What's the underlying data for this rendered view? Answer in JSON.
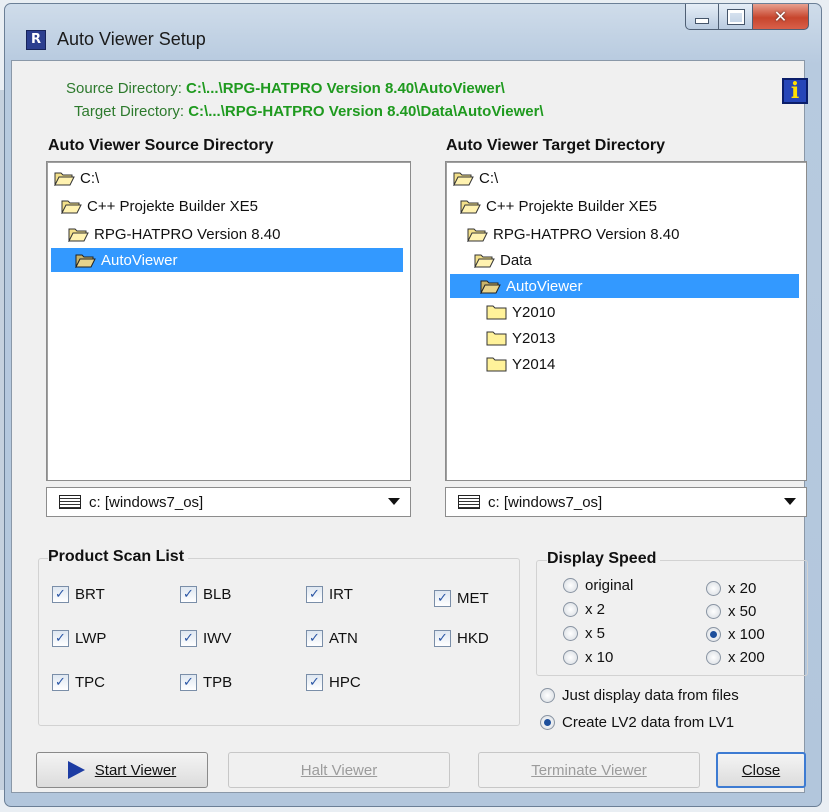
{
  "window": {
    "title": "Auto Viewer Setup"
  },
  "info": {
    "source_label": "Source Directory:",
    "source_value": "C:\\...\\RPG-HATPRO Version 8.40\\AutoViewer\\",
    "target_label": "Target Directory:",
    "target_value": "C:\\...\\RPG-HATPRO Version 8.40\\Data\\AutoViewer\\"
  },
  "source_panel": {
    "heading": "Auto Viewer Source Directory",
    "tree": [
      "C:\\",
      "C++ Projekte Builder XE5",
      "RPG-HATPRO Version 8.40",
      "AutoViewer"
    ],
    "drive": "c: [windows7_os]"
  },
  "target_panel": {
    "heading": "Auto Viewer Target Directory",
    "tree": [
      "C:\\",
      "C++ Projekte Builder XE5",
      "RPG-HATPRO Version 8.40",
      "Data",
      "AutoViewer",
      "Y2010",
      "Y2013",
      "Y2014"
    ],
    "drive": "c: [windows7_os]"
  },
  "product_scan": {
    "heading": "Product Scan List",
    "items": [
      {
        "label": "BRT",
        "checked": true
      },
      {
        "label": "BLB",
        "checked": true
      },
      {
        "label": "IRT",
        "checked": true
      },
      {
        "label": "MET",
        "checked": true
      },
      {
        "label": "LWP",
        "checked": true
      },
      {
        "label": "IWV",
        "checked": true
      },
      {
        "label": "ATN",
        "checked": true
      },
      {
        "label": "HKD",
        "checked": true
      },
      {
        "label": "TPC",
        "checked": true
      },
      {
        "label": "TPB",
        "checked": true
      },
      {
        "label": "HPC",
        "checked": true
      }
    ]
  },
  "display_speed": {
    "heading": "Display Speed",
    "options": [
      "original",
      "x 2",
      "x 5",
      "x 10",
      "x 20",
      "x 50",
      "x 100",
      "x 200"
    ],
    "selected": "x 100"
  },
  "mode": {
    "options": [
      "Just display data from files",
      "Create LV2 data from LV1"
    ],
    "selected": "Create LV2 data from LV1"
  },
  "buttons": {
    "start": "Start Viewer",
    "halt": "Halt Viewer",
    "terminate": "Terminate Viewer",
    "close": "Close"
  },
  "colors": {
    "path_green": "#1f9a1f",
    "selection": "#3399ff",
    "info_icon": "#2646b8"
  }
}
